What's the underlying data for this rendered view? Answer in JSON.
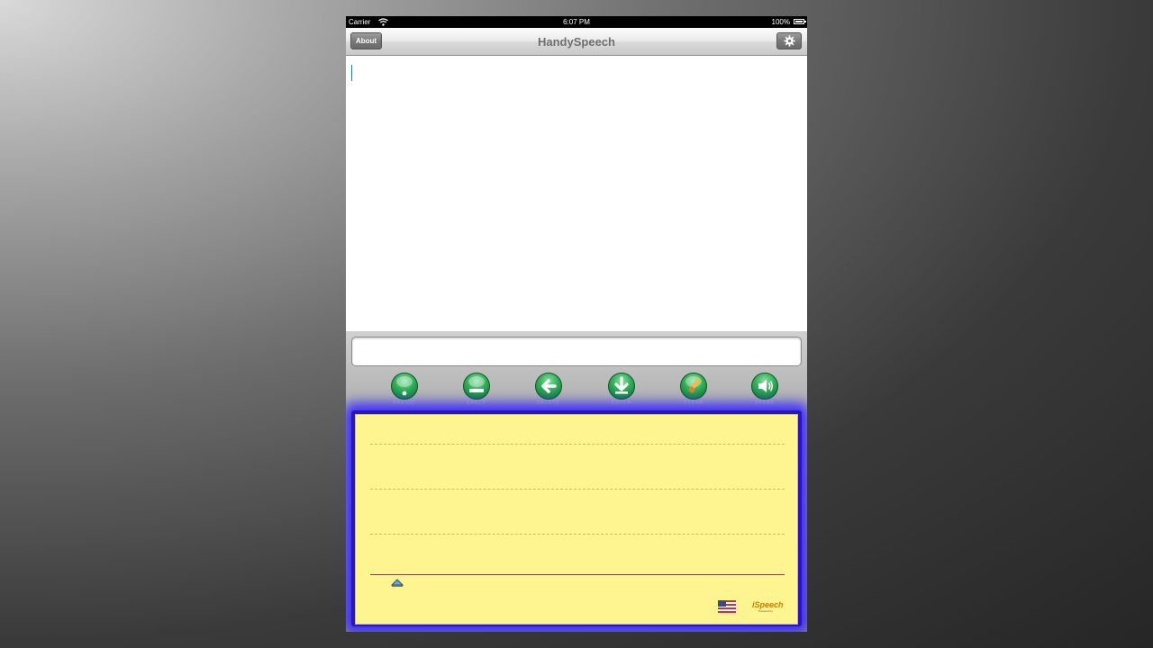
{
  "status_bar": {
    "carrier": "Carrier",
    "time": "6:07 PM",
    "battery": "100%"
  },
  "nav_bar": {
    "title": "HandySpeech",
    "about_label": "About"
  },
  "text_area": {
    "value": ""
  },
  "input": {
    "value": ""
  },
  "toolbar": [
    {
      "label": "PERIOD",
      "icon": "period-icon"
    },
    {
      "label": "SPACE",
      "icon": "space-icon"
    },
    {
      "label": "DELETE",
      "icon": "back-arrow-icon"
    },
    {
      "label": "ENTER",
      "icon": "down-arrow-icon"
    },
    {
      "label": "CLEAR",
      "icon": "eraser-icon"
    },
    {
      "label": "SPEAK",
      "icon": "speaker-icon"
    }
  ],
  "logo": {
    "text": "iSpeech",
    "sub": "Powered by"
  },
  "colors": {
    "pad": "#fef590",
    "glow": "#3b2bff",
    "button_green": "#35b25b"
  }
}
